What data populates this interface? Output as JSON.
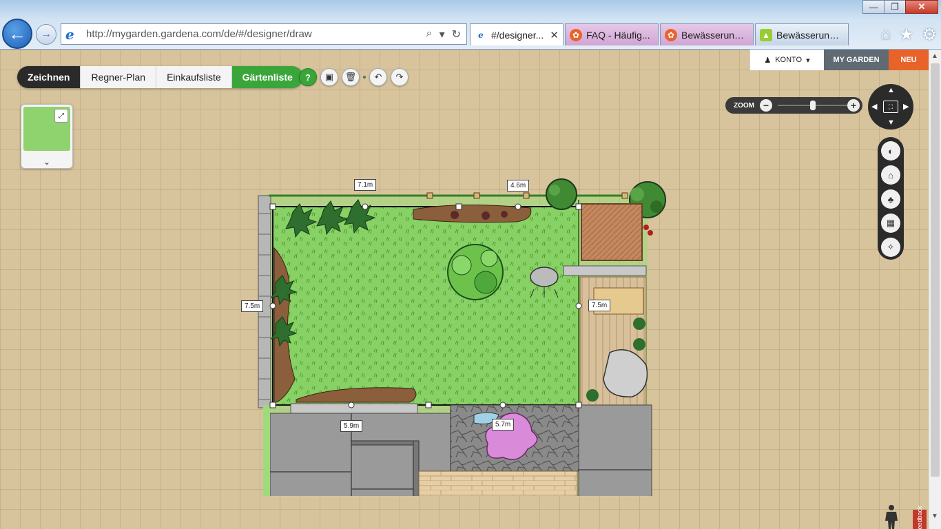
{
  "browser": {
    "url": "http://mygarden.gardena.com/de/#/designer/draw",
    "tabs": [
      {
        "label": "#/designer...",
        "active": true
      },
      {
        "label": "FAQ - Häufig...",
        "active": false
      },
      {
        "label": "Bewässerungs...",
        "active": false
      },
      {
        "label": "Bewässerung ...",
        "active": false
      }
    ],
    "window_buttons": [
      "—",
      "❐",
      "✕"
    ],
    "icons": [
      "home-icon",
      "star-icon",
      "gear-icon"
    ]
  },
  "account": {
    "konto": "KONTO",
    "my_garden": "MY GARDEN",
    "neu": "NEU"
  },
  "toolbar": {
    "tabs": [
      {
        "label": "Zeichnen",
        "active": true
      },
      {
        "label": "Regner-Plan",
        "active": false
      },
      {
        "label": "Einkaufsliste",
        "active": false
      },
      {
        "label": "Gärtenliste",
        "active": false
      }
    ],
    "help_label": "?"
  },
  "zoom": {
    "label": "ZOOM",
    "minus": "−",
    "plus": "+",
    "level": 0.5
  },
  "measurements": {
    "top_left": "7.1m",
    "top_right": "4.6m",
    "left": "7.5m",
    "right": "7.5m",
    "bottom_left": "5.9m",
    "bottom_right": "5.7m"
  },
  "feedback": "Feedback",
  "colors": {
    "accent_green": "#3aa63a",
    "accent_orange": "#e8632a",
    "lawn": "#8fd36f"
  }
}
